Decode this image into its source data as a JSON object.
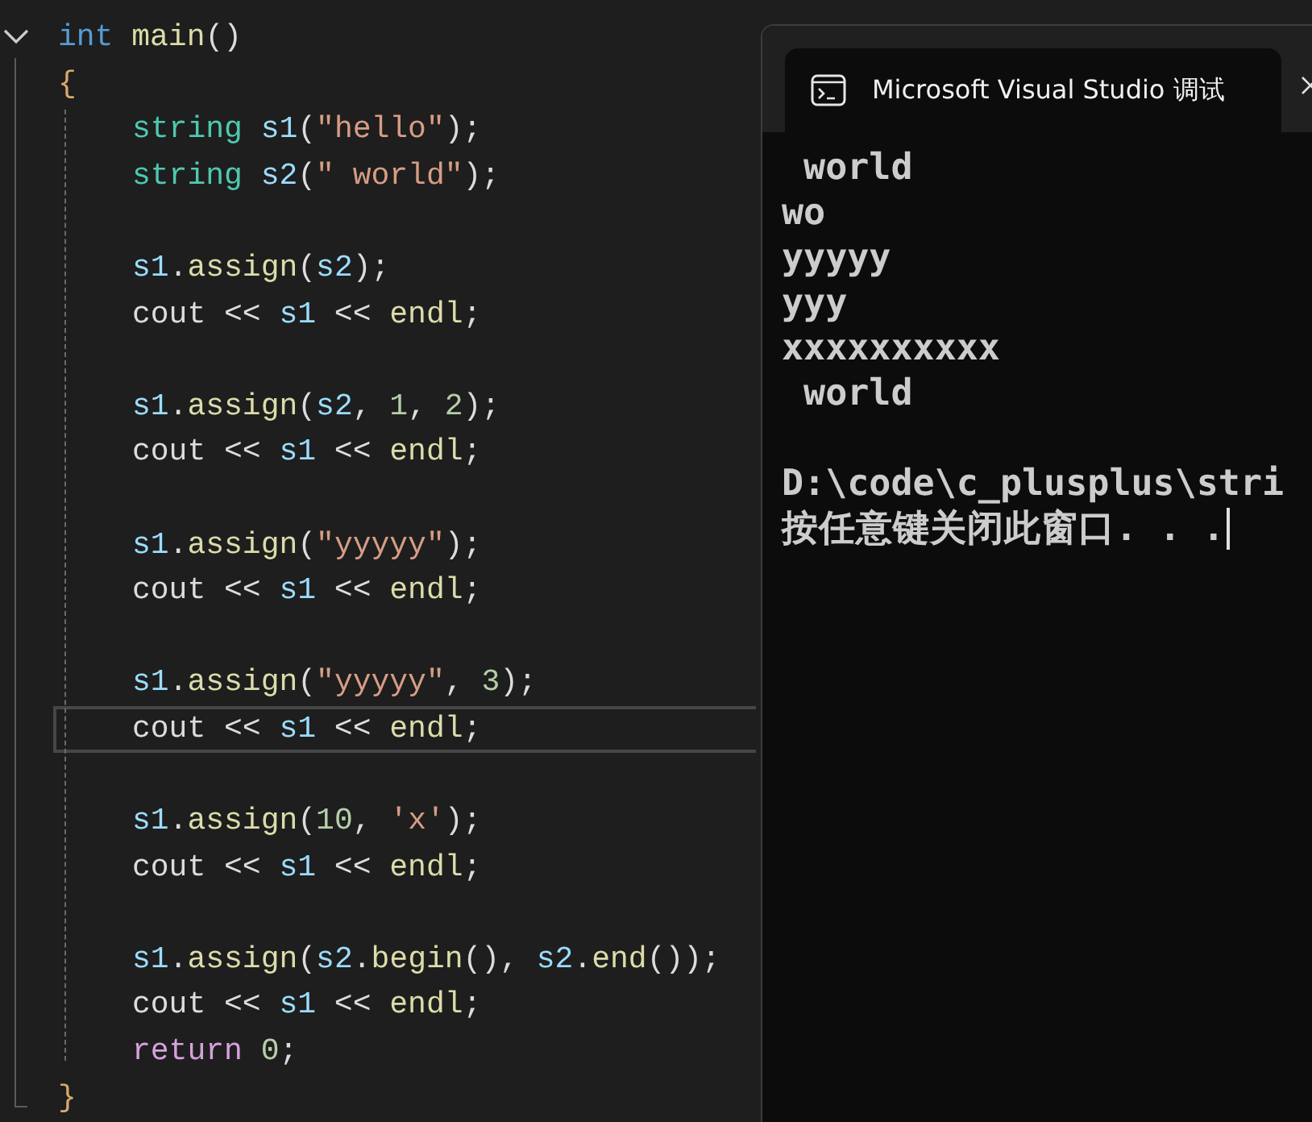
{
  "editor": {
    "lines": [
      {
        "kind": "top",
        "current": false,
        "tokens": [
          {
            "kind": "keyword",
            "text": "int"
          },
          {
            "kind": "func",
            "text": " main"
          },
          {
            "kind": "punct",
            "text": "()"
          }
        ]
      },
      {
        "kind": "top",
        "current": false,
        "tokens": [
          {
            "kind": "brace",
            "text": "{"
          }
        ]
      },
      {
        "kind": "body",
        "current": false,
        "tokens": [
          {
            "kind": "type",
            "text": "string"
          },
          {
            "kind": "var",
            "text": " s1"
          },
          {
            "kind": "punct",
            "text": "("
          },
          {
            "kind": "string",
            "text": "\"hello\""
          },
          {
            "kind": "punct",
            "text": ");"
          }
        ]
      },
      {
        "kind": "body",
        "current": false,
        "tokens": [
          {
            "kind": "type",
            "text": "string"
          },
          {
            "kind": "var",
            "text": " s2"
          },
          {
            "kind": "punct",
            "text": "("
          },
          {
            "kind": "string",
            "text": "\" world\""
          },
          {
            "kind": "punct",
            "text": ");"
          }
        ]
      },
      {
        "kind": "blank",
        "current": false
      },
      {
        "kind": "body",
        "current": false,
        "tokens": [
          {
            "kind": "var",
            "text": "s1"
          },
          {
            "kind": "punct",
            "text": "."
          },
          {
            "kind": "func",
            "text": "assign"
          },
          {
            "kind": "punct",
            "text": "("
          },
          {
            "kind": "var",
            "text": "s2"
          },
          {
            "kind": "punct",
            "text": ");"
          }
        ]
      },
      {
        "kind": "body",
        "current": false,
        "tokens": [
          {
            "kind": "plain",
            "text": "cout << "
          },
          {
            "kind": "var",
            "text": "s1"
          },
          {
            "kind": "plain",
            "text": " << "
          },
          {
            "kind": "func",
            "text": "endl"
          },
          {
            "kind": "punct",
            "text": ";"
          }
        ]
      },
      {
        "kind": "blank",
        "current": false
      },
      {
        "kind": "body",
        "current": false,
        "tokens": [
          {
            "kind": "var",
            "text": "s1"
          },
          {
            "kind": "punct",
            "text": "."
          },
          {
            "kind": "func",
            "text": "assign"
          },
          {
            "kind": "punct",
            "text": "("
          },
          {
            "kind": "var",
            "text": "s2"
          },
          {
            "kind": "punct",
            "text": ", "
          },
          {
            "kind": "number",
            "text": "1"
          },
          {
            "kind": "punct",
            "text": ", "
          },
          {
            "kind": "number",
            "text": "2"
          },
          {
            "kind": "punct",
            "text": ");"
          }
        ]
      },
      {
        "kind": "body",
        "current": false,
        "tokens": [
          {
            "kind": "plain",
            "text": "cout << "
          },
          {
            "kind": "var",
            "text": "s1"
          },
          {
            "kind": "plain",
            "text": " << "
          },
          {
            "kind": "func",
            "text": "endl"
          },
          {
            "kind": "punct",
            "text": ";"
          }
        ]
      },
      {
        "kind": "blank",
        "current": false
      },
      {
        "kind": "body",
        "current": false,
        "tokens": [
          {
            "kind": "var",
            "text": "s1"
          },
          {
            "kind": "punct",
            "text": "."
          },
          {
            "kind": "func",
            "text": "assign"
          },
          {
            "kind": "punct",
            "text": "("
          },
          {
            "kind": "string",
            "text": "\"yyyyy\""
          },
          {
            "kind": "punct",
            "text": ");"
          }
        ]
      },
      {
        "kind": "body",
        "current": false,
        "tokens": [
          {
            "kind": "plain",
            "text": "cout << "
          },
          {
            "kind": "var",
            "text": "s1"
          },
          {
            "kind": "plain",
            "text": " << "
          },
          {
            "kind": "func",
            "text": "endl"
          },
          {
            "kind": "punct",
            "text": ";"
          }
        ]
      },
      {
        "kind": "blank",
        "current": false
      },
      {
        "kind": "body",
        "current": false,
        "tokens": [
          {
            "kind": "var",
            "text": "s1"
          },
          {
            "kind": "punct",
            "text": "."
          },
          {
            "kind": "func",
            "text": "assign"
          },
          {
            "kind": "punct",
            "text": "("
          },
          {
            "kind": "string",
            "text": "\"yyyyy\""
          },
          {
            "kind": "punct",
            "text": ", "
          },
          {
            "kind": "number",
            "text": "3"
          },
          {
            "kind": "punct",
            "text": ");"
          }
        ]
      },
      {
        "kind": "body",
        "current": true,
        "tokens": [
          {
            "kind": "plain",
            "text": "cout << "
          },
          {
            "kind": "var",
            "text": "s1"
          },
          {
            "kind": "plain",
            "text": " << "
          },
          {
            "kind": "func",
            "text": "endl"
          },
          {
            "kind": "punct",
            "text": ";"
          }
        ]
      },
      {
        "kind": "blank",
        "current": false
      },
      {
        "kind": "body",
        "current": false,
        "tokens": [
          {
            "kind": "var",
            "text": "s1"
          },
          {
            "kind": "punct",
            "text": "."
          },
          {
            "kind": "func",
            "text": "assign"
          },
          {
            "kind": "punct",
            "text": "("
          },
          {
            "kind": "number",
            "text": "10"
          },
          {
            "kind": "punct",
            "text": ", "
          },
          {
            "kind": "string",
            "text": "'x'"
          },
          {
            "kind": "punct",
            "text": ");"
          }
        ]
      },
      {
        "kind": "body",
        "current": false,
        "tokens": [
          {
            "kind": "plain",
            "text": "cout << "
          },
          {
            "kind": "var",
            "text": "s1"
          },
          {
            "kind": "plain",
            "text": " << "
          },
          {
            "kind": "func",
            "text": "endl"
          },
          {
            "kind": "punct",
            "text": ";"
          }
        ]
      },
      {
        "kind": "blank",
        "current": false
      },
      {
        "kind": "body",
        "current": false,
        "tokens": [
          {
            "kind": "var",
            "text": "s1"
          },
          {
            "kind": "punct",
            "text": "."
          },
          {
            "kind": "func",
            "text": "assign"
          },
          {
            "kind": "punct",
            "text": "("
          },
          {
            "kind": "var",
            "text": "s2"
          },
          {
            "kind": "punct",
            "text": "."
          },
          {
            "kind": "func",
            "text": "begin"
          },
          {
            "kind": "punct",
            "text": "(), "
          },
          {
            "kind": "var",
            "text": "s2"
          },
          {
            "kind": "punct",
            "text": "."
          },
          {
            "kind": "func",
            "text": "end"
          },
          {
            "kind": "punct",
            "text": "());"
          }
        ]
      },
      {
        "kind": "body",
        "current": false,
        "tokens": [
          {
            "kind": "plain",
            "text": "cout << "
          },
          {
            "kind": "var",
            "text": "s1"
          },
          {
            "kind": "plain",
            "text": " << "
          },
          {
            "kind": "func",
            "text": "endl"
          },
          {
            "kind": "punct",
            "text": ";"
          }
        ]
      },
      {
        "kind": "body",
        "current": false,
        "tokens": [
          {
            "kind": "control",
            "text": "return"
          },
          {
            "kind": "number",
            "text": " 0"
          },
          {
            "kind": "punct",
            "text": ";"
          }
        ]
      },
      {
        "kind": "top",
        "current": false,
        "tokens": [
          {
            "kind": "brace",
            "text": "}"
          }
        ]
      }
    ]
  },
  "terminal": {
    "tab_title": "Microsoft Visual Studio 调试",
    "output": [
      " world",
      "wo",
      "yyyyy",
      "yyy",
      "xxxxxxxxxx",
      " world"
    ],
    "prompt": [
      "D:\\code\\c_plusplus\\stri",
      "按任意键关闭此窗口. . ."
    ]
  }
}
